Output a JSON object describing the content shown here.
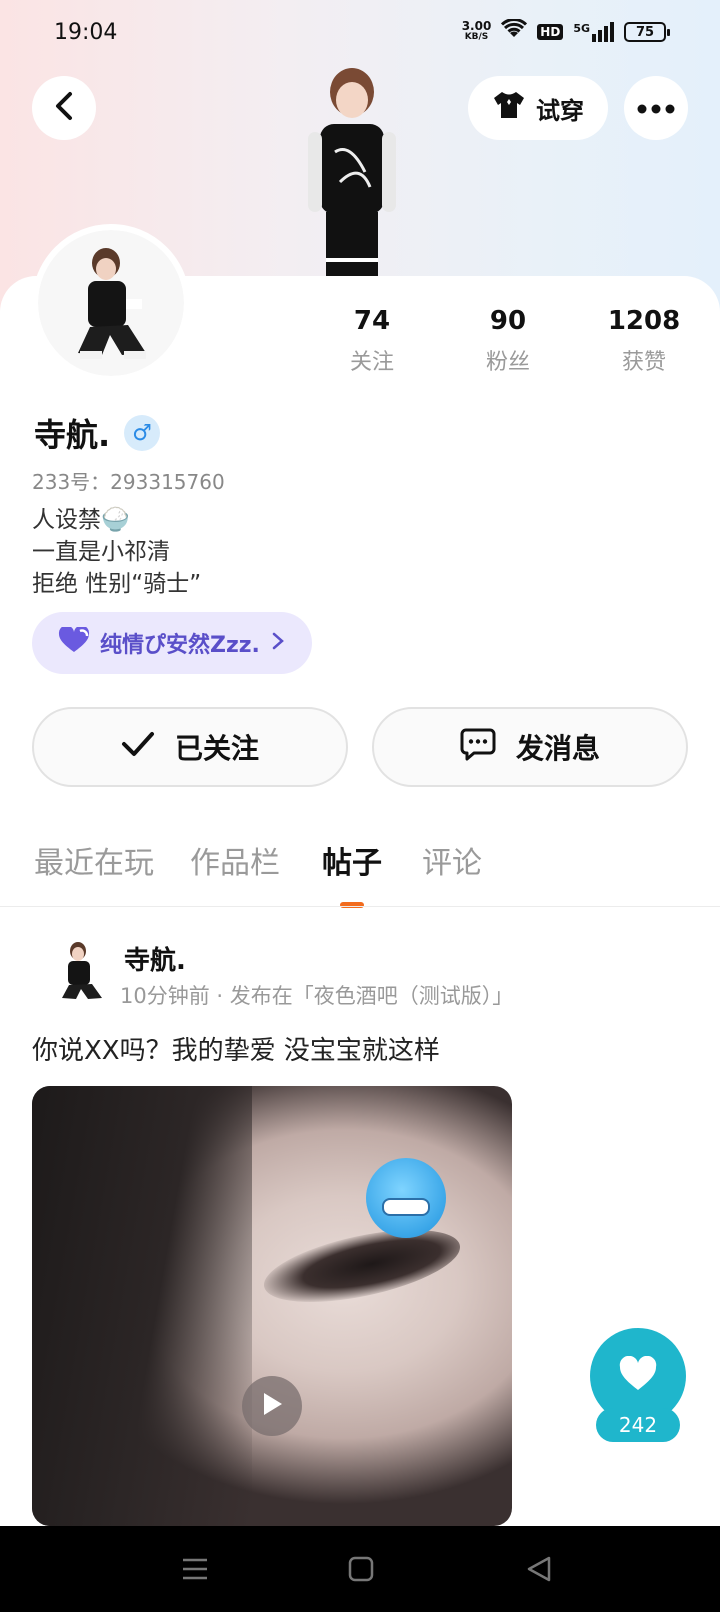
{
  "status_bar": {
    "time": "19:04",
    "net_speed_value": "3.00",
    "net_speed_unit": "KB/S",
    "hd": "HD",
    "signal": "5G",
    "battery": "75"
  },
  "header": {
    "back_icon": "chevron-left-icon",
    "tryon_label": "试穿",
    "more_icon": "more-dots-icon"
  },
  "stats": [
    {
      "value": "74",
      "label": "关注"
    },
    {
      "value": "90",
      "label": "粉丝"
    },
    {
      "value": "1208",
      "label": "获赞"
    }
  ],
  "profile": {
    "username": "寺航.",
    "gender_symbol": "♂",
    "uid_line": "233号：293315760",
    "bio_lines": [
      "人设禁🍚",
      "一直是小祁清",
      "拒绝 性别“骑士”"
    ],
    "tag_label": "纯情ぴ安然Zzz."
  },
  "actions": {
    "follow_label": "已关注",
    "message_label": "发消息"
  },
  "tabs": [
    "最近在玩",
    "作品栏",
    "帖子",
    "评论"
  ],
  "active_tab": "帖子",
  "post": {
    "username": "寺航.",
    "meta": "10分钟前 · 发布在「夜色酒吧（测试版）」",
    "text": "你说XX吗？我的挚爱 没宝宝就这样"
  },
  "like": {
    "count": "242"
  },
  "colors": {
    "accent_orange": "#f26b1d",
    "like_teal": "#1fb6cc",
    "tag_purple": "#5a4fc9",
    "tag_bg": "#ebe8fd",
    "gender_blue": "#2b8be6"
  }
}
